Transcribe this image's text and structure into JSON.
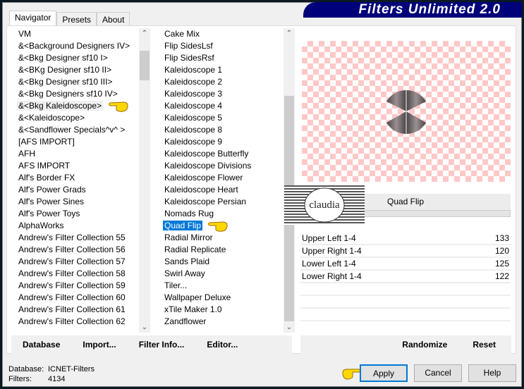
{
  "title": "Filters Unlimited 2.0",
  "tabs": [
    "Navigator",
    "Presets",
    "About"
  ],
  "categories": [
    "VM",
    "&<Background Designers IV>",
    "&<Bkg Designer sf10 I>",
    "&<BKg Designer sf10 II>",
    "&<Bkg Designer sf10 III>",
    "&<Bkg Designers sf10 IV>",
    "&<Bkg Kaleidoscope>",
    "&<Kaleidoscope>",
    "&<Sandflower Specials^v^ >",
    "[AFS IMPORT]",
    "AFH",
    "AFS IMPORT",
    "Alf's Border FX",
    "Alf's Power Grads",
    "Alf's Power Sines",
    "Alf's Power Toys",
    "AlphaWorks",
    "Andrew's Filter Collection 55",
    "Andrew's Filter Collection 56",
    "Andrew's Filter Collection 57",
    "Andrew's Filter Collection 58",
    "Andrew's Filter Collection 59",
    "Andrew's Filter Collection 60",
    "Andrew's Filter Collection 61",
    "Andrew's Filter Collection 62"
  ],
  "selected_category": "&<Bkg Kaleidoscope>",
  "filters": [
    "Cake Mix",
    "Flip SidesLsf",
    "Flip SidesRsf",
    "Kaleidoscope 1",
    "Kaleidoscope 2",
    "Kaleidoscope 3",
    "Kaleidoscope 4",
    "Kaleidoscope 5",
    "Kaleidoscope 8",
    "Kaleidoscope 9",
    "Kaleidoscope Butterfly",
    "Kaleidoscope Divisions",
    "Kaleidoscope Flower",
    "Kaleidoscope Heart",
    "Kaleidoscope Persian",
    "Nomads Rug",
    "Quad Flip",
    "Radial Mirror",
    "Radial Replicate",
    "Sands Plaid",
    "Swirl Away",
    "Tiler...",
    "Wallpaper Deluxe",
    "xTile Maker 1.0",
    "Zandflower"
  ],
  "selected_filter": "Quad Flip",
  "filter_name": "Quad Flip",
  "params": [
    {
      "label": "Upper Left 1-4",
      "value": "133"
    },
    {
      "label": "Upper Right 1-4",
      "value": "120"
    },
    {
      "label": "Lower Left 1-4",
      "value": "125"
    },
    {
      "label": "Lower Right 1-4",
      "value": "122"
    }
  ],
  "left_buttons": [
    "Database",
    "Import...",
    "Filter Info...",
    "Editor..."
  ],
  "right_buttons": [
    "Randomize",
    "Reset"
  ],
  "status": {
    "database_label": "Database:",
    "database_value": "ICNET-Filters",
    "filters_label": "Filters:",
    "filters_value": "4134"
  },
  "dialog_buttons": {
    "apply": "Apply",
    "cancel": "Cancel",
    "help": "Help"
  },
  "colors": {
    "banner": "#00007a",
    "selection": "#0078d7",
    "checker": "#ffc8c8"
  }
}
